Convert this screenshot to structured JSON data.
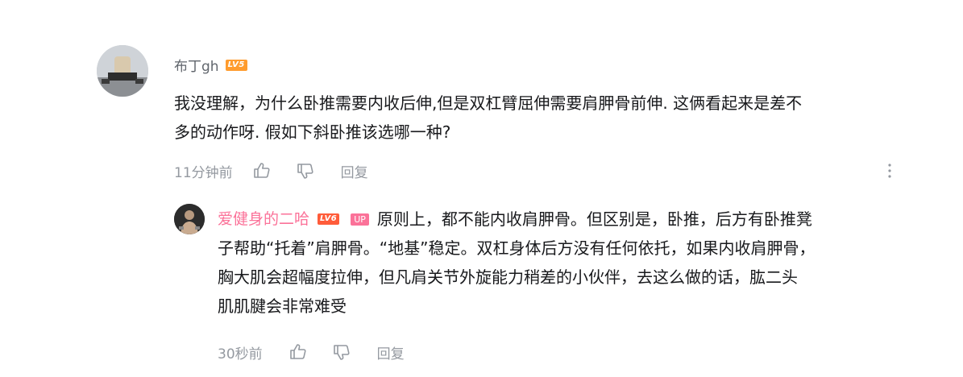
{
  "comment": {
    "username": "布丁gh",
    "level_badge": "LV5",
    "text_line1": "我没理解，为什么卧推需要内收后伸,但是双杠臂屈伸需要肩胛骨前伸. 这俩看起来是差不",
    "text_line2": "多的动作呀. 假如下斜卧推该选哪一种?",
    "time": "11分钟前",
    "reply_label": "回复",
    "icons": [
      "like-icon",
      "dislike-icon",
      "more-icon"
    ]
  },
  "reply": {
    "username": "爱健身的二哈",
    "level_badge": "LV6",
    "up_badge": "UP",
    "username_color": "#fb7299",
    "text_line1": "原则上，都不能内收肩胛骨。但区别是，卧推，后方有卧推凳",
    "text_line2": "子帮助“托着”肩胛骨。“地基”稳定。双杠身体后方没有任何依托，如果内收肩胛骨，",
    "text_line3": "胸大肌会超幅度拉伸，但凡肩关节外旋能力稍差的小伙伴，去这么做的话，肱二头",
    "text_line4": "肌肌腱会非常难受",
    "time": "30秒前",
    "reply_label": "回复"
  }
}
